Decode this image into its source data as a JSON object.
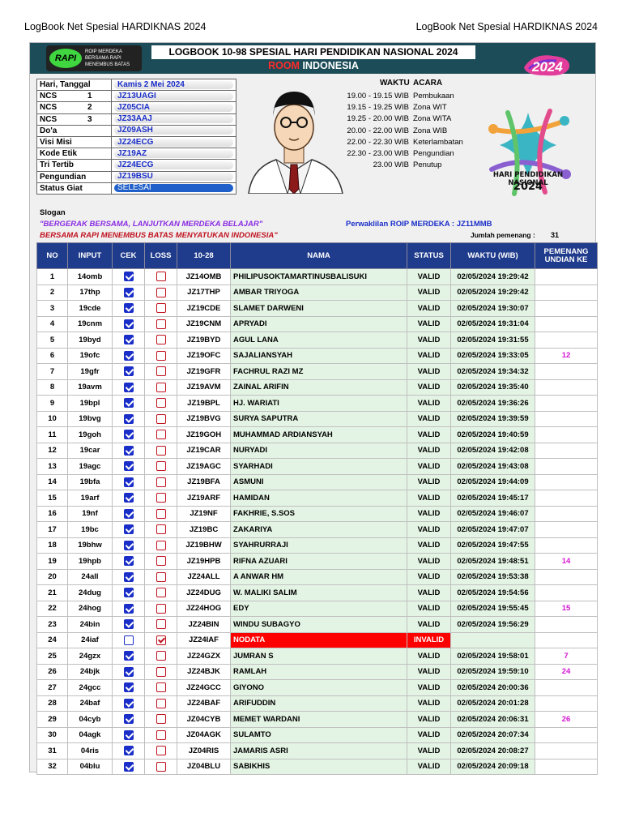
{
  "page_header": {
    "left": "LogBook Net Spesial HARDIKNAS 2024",
    "right": "LogBook Net Spesial HARDIKNAS 2024"
  },
  "banner": {
    "title": "LOGBOOK 10-98 SPESIAL HARI PENDIDIKAN NASIONAL 2024",
    "room_word": "ROOM",
    "room_name": "INDONESIA",
    "logo_left_text": "RAPI",
    "logo_left_lines": [
      "ROIP MERDEKA",
      "BERSAMA RAPI",
      "MENEMBUS BATAS",
      "MENYATUKAN INDONESIA"
    ],
    "logo_right_text": "2024"
  },
  "info": [
    {
      "key": "Hari, Tanggal",
      "num": "",
      "value": "Kamis 2 Mei 2024"
    },
    {
      "key": "NCS",
      "num": "1",
      "value": "JZ13UAGI"
    },
    {
      "key": "NCS",
      "num": "2",
      "value": "JZ05CIA"
    },
    {
      "key": "NCS",
      "num": "3",
      "value": "JZ33AAJ"
    },
    {
      "key": "Do'a",
      "num": "",
      "value": "JZ09ASH"
    },
    {
      "key": "Visi Misi",
      "num": "",
      "value": "JZ24ECG"
    },
    {
      "key": "Kode Etik",
      "num": "",
      "value": "JZ19AZ"
    },
    {
      "key": "Tri Tertib",
      "num": "",
      "value": "JZ24ECG"
    },
    {
      "key": "Pengundian",
      "num": "",
      "value": "JZ19BSU"
    },
    {
      "key": "Status Giat",
      "num": "",
      "value": "SELESAI"
    }
  ],
  "schedule": {
    "col_time": "WAKTU",
    "col_event": "ACARA",
    "rows": [
      {
        "time": "19.00 - 19.15 WIB",
        "event": "Pembukaan"
      },
      {
        "time": "19.15 - 19.25 WIB",
        "event": "Zona WIT"
      },
      {
        "time": "19.25 - 20.00 WIB",
        "event": "Zona WITA"
      },
      {
        "time": "20.00 - 22.00 WIB",
        "event": "Zona WIB"
      },
      {
        "time": "22.00 - 22.30 WIB",
        "event": "Keterlambatan"
      },
      {
        "time": "22.30 - 23.00 WIB",
        "event": "Pengundian"
      },
      {
        "time": "23.00 WIB",
        "event": "Penutup"
      }
    ]
  },
  "hardiknas_logo": {
    "line1": "HARI PENDIDIKAN NASIONAL",
    "line2": "2024"
  },
  "slogan": {
    "label": "Slogan",
    "line1": "\"BERGERAK BERSAMA, LANJUTKAN MERDEKA BELAJAR\"",
    "line2": "BERSAMA RAPI MENEMBUS BATAS MENYATUKAN INDONESIA\""
  },
  "perwakilan": "Perwaklilan ROIP MERDEKA  :  JZ11MMB",
  "winners": {
    "label": "Jumlah pemenang :",
    "count": "31"
  },
  "log_headers": [
    "NO",
    "INPUT",
    "CEK",
    "LOSS",
    "10-28",
    "NAMA",
    "STATUS",
    "WAKTU (WIB)",
    "PEMENANG UNDIAN KE"
  ],
  "log_rows": [
    {
      "no": "1",
      "input": "14omb",
      "cek": true,
      "loss": false,
      "call": "JZ14OMB",
      "nama": "PHILIPUSOKTAMARTINUSBALISUKI",
      "status": "VALID",
      "waktu": "02/05/2024 19:29:42",
      "pemenang": ""
    },
    {
      "no": "2",
      "input": "17thp",
      "cek": true,
      "loss": false,
      "call": "JZ17THP",
      "nama": "AMBAR TRIYOGA",
      "status": "VALID",
      "waktu": "02/05/2024 19:29:42",
      "pemenang": ""
    },
    {
      "no": "3",
      "input": "19cde",
      "cek": true,
      "loss": false,
      "call": "JZ19CDE",
      "nama": "SLAMET DARWENI",
      "status": "VALID",
      "waktu": "02/05/2024 19:30:07",
      "pemenang": ""
    },
    {
      "no": "4",
      "input": "19cnm",
      "cek": true,
      "loss": false,
      "call": "JZ19CNM",
      "nama": "APRYADI",
      "status": "VALID",
      "waktu": "02/05/2024 19:31:04",
      "pemenang": ""
    },
    {
      "no": "5",
      "input": "19byd",
      "cek": true,
      "loss": false,
      "call": "JZ19BYD",
      "nama": "AGUL LANA",
      "status": "VALID",
      "waktu": "02/05/2024 19:31:55",
      "pemenang": ""
    },
    {
      "no": "6",
      "input": "19ofc",
      "cek": true,
      "loss": false,
      "call": "JZ19OFC",
      "nama": "SAJALIANSYAH",
      "status": "VALID",
      "waktu": "02/05/2024 19:33:05",
      "pemenang": "12"
    },
    {
      "no": "7",
      "input": "19gfr",
      "cek": true,
      "loss": false,
      "call": "JZ19GFR",
      "nama": "FACHRUL RAZI MZ",
      "status": "VALID",
      "waktu": "02/05/2024 19:34:32",
      "pemenang": ""
    },
    {
      "no": "8",
      "input": "19avm",
      "cek": true,
      "loss": false,
      "call": "JZ19AVM",
      "nama": "ZAINAL ARIFIN",
      "status": "VALID",
      "waktu": "02/05/2024 19:35:40",
      "pemenang": ""
    },
    {
      "no": "9",
      "input": "19bpl",
      "cek": true,
      "loss": false,
      "call": "JZ19BPL",
      "nama": "HJ. WARIATI",
      "status": "VALID",
      "waktu": "02/05/2024 19:36:26",
      "pemenang": ""
    },
    {
      "no": "10",
      "input": "19bvg",
      "cek": true,
      "loss": false,
      "call": "JZ19BVG",
      "nama": "SURYA SAPUTRA",
      "status": "VALID",
      "waktu": "02/05/2024 19:39:59",
      "pemenang": ""
    },
    {
      "no": "11",
      "input": "19goh",
      "cek": true,
      "loss": false,
      "call": "JZ19GOH",
      "nama": "MUHAMMAD ARDIANSYAH",
      "status": "VALID",
      "waktu": "02/05/2024 19:40:59",
      "pemenang": ""
    },
    {
      "no": "12",
      "input": "19car",
      "cek": true,
      "loss": false,
      "call": "JZ19CAR",
      "nama": "NURYADI",
      "status": "VALID",
      "waktu": "02/05/2024 19:42:08",
      "pemenang": ""
    },
    {
      "no": "13",
      "input": "19agc",
      "cek": true,
      "loss": false,
      "call": "JZ19AGC",
      "nama": "SYARHADI",
      "status": "VALID",
      "waktu": "02/05/2024 19:43:08",
      "pemenang": ""
    },
    {
      "no": "14",
      "input": "19bfa",
      "cek": true,
      "loss": false,
      "call": "JZ19BFA",
      "nama": "ASMUNI",
      "status": "VALID",
      "waktu": "02/05/2024 19:44:09",
      "pemenang": ""
    },
    {
      "no": "15",
      "input": "19arf",
      "cek": true,
      "loss": false,
      "call": "JZ19ARF",
      "nama": "HAMIDAN",
      "status": "VALID",
      "waktu": "02/05/2024 19:45:17",
      "pemenang": ""
    },
    {
      "no": "16",
      "input": "19nf",
      "cek": true,
      "loss": false,
      "call": "JZ19NF",
      "nama": "FAKHRIE, S.SOS",
      "status": "VALID",
      "waktu": "02/05/2024 19:46:07",
      "pemenang": ""
    },
    {
      "no": "17",
      "input": "19bc",
      "cek": true,
      "loss": false,
      "call": "JZ19BC",
      "nama": "ZAKARIYA",
      "status": "VALID",
      "waktu": "02/05/2024 19:47:07",
      "pemenang": ""
    },
    {
      "no": "18",
      "input": "19bhw",
      "cek": true,
      "loss": false,
      "call": "JZ19BHW",
      "nama": "SYAHRURRAJI",
      "status": "VALID",
      "waktu": "02/05/2024 19:47:55",
      "pemenang": ""
    },
    {
      "no": "19",
      "input": "19hpb",
      "cek": true,
      "loss": false,
      "call": "JZ19HPB",
      "nama": "RIFNA AZUARI",
      "status": "VALID",
      "waktu": "02/05/2024 19:48:51",
      "pemenang": "14"
    },
    {
      "no": "20",
      "input": "24all",
      "cek": true,
      "loss": false,
      "call": "JZ24ALL",
      "nama": "A ANWAR HM",
      "status": "VALID",
      "waktu": "02/05/2024 19:53:38",
      "pemenang": ""
    },
    {
      "no": "21",
      "input": "24dug",
      "cek": true,
      "loss": false,
      "call": "JZ24DUG",
      "nama": "W. MALIKI SALIM",
      "status": "VALID",
      "waktu": "02/05/2024 19:54:56",
      "pemenang": ""
    },
    {
      "no": "22",
      "input": "24hog",
      "cek": true,
      "loss": false,
      "call": "JZ24HOG",
      "nama": "EDY",
      "status": "VALID",
      "waktu": "02/05/2024 19:55:45",
      "pemenang": "15"
    },
    {
      "no": "23",
      "input": "24bin",
      "cek": true,
      "loss": false,
      "call": "JZ24BIN",
      "nama": "WINDU SUBAGYO",
      "status": "VALID",
      "waktu": "02/05/2024 19:56:29",
      "pemenang": ""
    },
    {
      "no": "24",
      "input": "24iaf",
      "cek": false,
      "loss": true,
      "call": "JZ24IAF",
      "nama": "NODATA",
      "status": "INVALID",
      "waktu": "",
      "pemenang": ""
    },
    {
      "no": "25",
      "input": "24gzx",
      "cek": true,
      "loss": false,
      "call": "JZ24GZX",
      "nama": "JUMRAN S",
      "status": "VALID",
      "waktu": "02/05/2024 19:58:01",
      "pemenang": "7"
    },
    {
      "no": "26",
      "input": "24bjk",
      "cek": true,
      "loss": false,
      "call": "JZ24BJK",
      "nama": "RAMLAH",
      "status": "VALID",
      "waktu": "02/05/2024 19:59:10",
      "pemenang": "24"
    },
    {
      "no": "27",
      "input": "24gcc",
      "cek": true,
      "loss": false,
      "call": "JZ24GCC",
      "nama": "GIYONO",
      "status": "VALID",
      "waktu": "02/05/2024 20:00:36",
      "pemenang": ""
    },
    {
      "no": "28",
      "input": "24baf",
      "cek": true,
      "loss": false,
      "call": "JZ24BAF",
      "nama": "ARIFUDDIN",
      "status": "VALID",
      "waktu": "02/05/2024 20:01:28",
      "pemenang": ""
    },
    {
      "no": "29",
      "input": "04cyb",
      "cek": true,
      "loss": false,
      "call": "JZ04CYB",
      "nama": "MEMET WARDANI",
      "status": "VALID",
      "waktu": "02/05/2024 20:06:31",
      "pemenang": "26"
    },
    {
      "no": "30",
      "input": "04agk",
      "cek": true,
      "loss": false,
      "call": "JZ04AGK",
      "nama": "SULAMTO",
      "status": "VALID",
      "waktu": "02/05/2024 20:07:34",
      "pemenang": ""
    },
    {
      "no": "31",
      "input": "04ris",
      "cek": true,
      "loss": false,
      "call": "JZ04RIS",
      "nama": "JAMARIS ASRI",
      "status": "VALID",
      "waktu": "02/05/2024 20:08:27",
      "pemenang": ""
    },
    {
      "no": "32",
      "input": "04blu",
      "cek": true,
      "loss": false,
      "call": "JZ04BLU",
      "nama": "SABIKHIS",
      "status": "VALID",
      "waktu": "02/05/2024 20:09:18",
      "pemenang": ""
    }
  ],
  "colors": {
    "header_blue": "#1f3b8c",
    "banner_teal": "#1b4c57",
    "valid_green": "#e4f4e4",
    "invalid_red": "#ff0000",
    "winner_magenta": "#d614d6"
  }
}
